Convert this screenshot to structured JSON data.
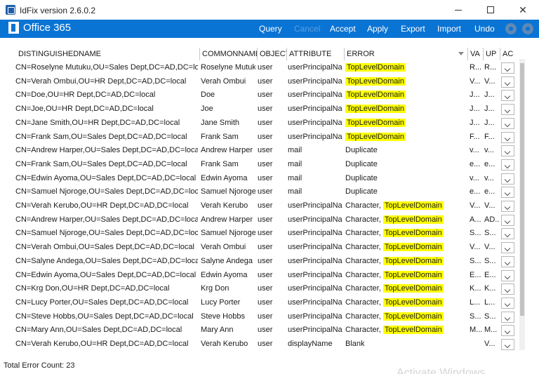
{
  "window": {
    "title": "IdFix version 2.6.0.2",
    "minimize_icon": "minimize-icon",
    "maximize_icon": "maximize-icon",
    "close_glyph": "✕"
  },
  "ribbon": {
    "brand": "Office 365",
    "menu": [
      {
        "label": "Query",
        "enabled": true
      },
      {
        "label": "Cancel",
        "enabled": false
      },
      {
        "label": "Accept",
        "enabled": true
      },
      {
        "label": "Apply",
        "enabled": true
      },
      {
        "label": "Export",
        "enabled": true
      },
      {
        "label": "Import",
        "enabled": true
      },
      {
        "label": "Undo",
        "enabled": true
      }
    ],
    "icons": [
      "gear-icon",
      "settings-icon"
    ]
  },
  "grid": {
    "columns": [
      "DISTINGUISHEDNAME",
      "COMMONNAME",
      "OBJECT",
      "ATTRIBUTE",
      "ERROR",
      "VA",
      "UP",
      "AC"
    ],
    "rows": [
      {
        "dn": "CN=Roselyne Mutuku,OU=Sales Dept,DC=AD,DC=local",
        "cn": "Roselyne Mutuku",
        "obj": "user",
        "attr": "userPrincipalNa...",
        "err_prefix": "",
        "err_hl": "TopLevelDomain",
        "va": "R...",
        "up": "R...",
        "action": ""
      },
      {
        "dn": "CN=Verah Ombui,OU=HR Dept,DC=AD,DC=local",
        "cn": "Verah Ombui",
        "obj": "user",
        "attr": "userPrincipalNa...",
        "err_prefix": "",
        "err_hl": "TopLevelDomain",
        "va": "V...",
        "up": "V...",
        "action": ""
      },
      {
        "dn": "CN=Doe,OU=HR Dept,DC=AD,DC=local",
        "cn": "Doe",
        "obj": "user",
        "attr": "userPrincipalNa...",
        "err_prefix": "",
        "err_hl": "TopLevelDomain",
        "va": "J...",
        "up": "J...",
        "action": ""
      },
      {
        "dn": "CN=Joe,OU=HR Dept,DC=AD,DC=local",
        "cn": "Joe",
        "obj": "user",
        "attr": "userPrincipalNa...",
        "err_prefix": "",
        "err_hl": "TopLevelDomain",
        "va": "J...",
        "up": "J...",
        "action": ""
      },
      {
        "dn": "CN=Jane Smith,OU=HR Dept,DC=AD,DC=local",
        "cn": "Jane Smith",
        "obj": "user",
        "attr": "userPrincipalNa...",
        "err_prefix": "",
        "err_hl": "TopLevelDomain",
        "va": "J...",
        "up": "J...",
        "action": ""
      },
      {
        "dn": "CN=Frank Sam,OU=Sales Dept,DC=AD,DC=local",
        "cn": "Frank Sam",
        "obj": "user",
        "attr": "userPrincipalNa...",
        "err_prefix": "",
        "err_hl": "TopLevelDomain",
        "va": "F...",
        "up": "F...",
        "action": ""
      },
      {
        "dn": "CN=Andrew Harper,OU=Sales Dept,DC=AD,DC=local",
        "cn": "Andrew Harper",
        "obj": "user",
        "attr": "mail",
        "err_prefix": "Duplicate",
        "err_hl": "",
        "va": "v...",
        "up": "v...",
        "action": ""
      },
      {
        "dn": "CN=Frank Sam,OU=Sales Dept,DC=AD,DC=local",
        "cn": "Frank Sam",
        "obj": "user",
        "attr": "mail",
        "err_prefix": "Duplicate",
        "err_hl": "",
        "va": "e...",
        "up": "e...",
        "action": ""
      },
      {
        "dn": "CN=Edwin Ayoma,OU=Sales Dept,DC=AD,DC=local",
        "cn": "Edwin Ayoma",
        "obj": "user",
        "attr": "mail",
        "err_prefix": "Duplicate",
        "err_hl": "",
        "va": "v...",
        "up": "v...",
        "action": ""
      },
      {
        "dn": "CN=Samuel Njoroge,OU=Sales Dept,DC=AD,DC=local",
        "cn": "Samuel Njoroge",
        "obj": "user",
        "attr": "mail",
        "err_prefix": "Duplicate",
        "err_hl": "",
        "va": "e...",
        "up": "e...",
        "action": ""
      },
      {
        "dn": "CN=Verah Kerubo,OU=HR Dept,DC=AD,DC=local",
        "cn": "Verah Kerubo",
        "obj": "user",
        "attr": "userPrincipalNa...",
        "err_prefix": "Character, ",
        "err_hl": "TopLevelDomain",
        "va": "V...",
        "up": "V...",
        "action": ""
      },
      {
        "dn": "CN=Andrew Harper,OU=Sales Dept,DC=AD,DC=local",
        "cn": "Andrew Harper",
        "obj": "user",
        "attr": "userPrincipalNa...",
        "err_prefix": "Character, ",
        "err_hl": "TopLevelDomain",
        "va": "A...",
        "up": "AD...",
        "action": ""
      },
      {
        "dn": "CN=Samuel Njoroge,OU=Sales Dept,DC=AD,DC=local",
        "cn": "Samuel Njoroge",
        "obj": "user",
        "attr": "userPrincipalNa...",
        "err_prefix": "Character, ",
        "err_hl": "TopLevelDomain",
        "va": "S...",
        "up": "S...",
        "action": ""
      },
      {
        "dn": "CN=Verah Ombui,OU=Sales Dept,DC=AD,DC=local",
        "cn": "Verah Ombui",
        "obj": "user",
        "attr": "userPrincipalNa...",
        "err_prefix": "Character, ",
        "err_hl": "TopLevelDomain",
        "va": "V...",
        "up": "V...",
        "action": ""
      },
      {
        "dn": "CN=Salyne Andega,OU=Sales Dept,DC=AD,DC=local",
        "cn": "Salyne Andega",
        "obj": "user",
        "attr": "userPrincipalNa...",
        "err_prefix": "Character, ",
        "err_hl": "TopLevelDomain",
        "va": "S...",
        "up": "S...",
        "action": ""
      },
      {
        "dn": "CN=Edwin Ayoma,OU=Sales Dept,DC=AD,DC=local",
        "cn": "Edwin Ayoma",
        "obj": "user",
        "attr": "userPrincipalNa...",
        "err_prefix": "Character, ",
        "err_hl": "TopLevelDomain",
        "va": "E...",
        "up": "E...",
        "action": ""
      },
      {
        "dn": "CN=Krg Don,OU=HR Dept,DC=AD,DC=local",
        "cn": "Krg Don",
        "obj": "user",
        "attr": "userPrincipalNa...",
        "err_prefix": "Character, ",
        "err_hl": "TopLevelDomain",
        "va": "K...",
        "up": "K...",
        "action": ""
      },
      {
        "dn": "CN=Lucy Porter,OU=Sales Dept,DC=AD,DC=local",
        "cn": "Lucy Porter",
        "obj": "user",
        "attr": "userPrincipalNa...",
        "err_prefix": "Character, ",
        "err_hl": "TopLevelDomain",
        "va": "L...",
        "up": "L...",
        "action": ""
      },
      {
        "dn": "CN=Steve Hobbs,OU=Sales Dept,DC=AD,DC=local",
        "cn": "Steve Hobbs",
        "obj": "user",
        "attr": "userPrincipalNa...",
        "err_prefix": "Character, ",
        "err_hl": "TopLevelDomain",
        "va": "S...",
        "up": "S...",
        "action": ""
      },
      {
        "dn": "CN=Mary Ann,OU=Sales Dept,DC=AD,DC=local",
        "cn": "Mary Ann",
        "obj": "user",
        "attr": "userPrincipalNa...",
        "err_prefix": "Character, ",
        "err_hl": "TopLevelDomain",
        "va": "M...",
        "up": "M...",
        "action": ""
      },
      {
        "dn": "CN=Verah Kerubo,OU=HR Dept,DC=AD,DC=local",
        "cn": "Verah Kerubo",
        "obj": "user",
        "attr": "displayName",
        "err_prefix": "Blank",
        "err_hl": "",
        "va": "",
        "up": "V...",
        "action": ""
      }
    ]
  },
  "status": {
    "total_error_count": "Total Error Count: 23"
  },
  "watermark": "Activate Windows",
  "colors": {
    "ribbon": "#0a74d4",
    "highlight": "#ffff00"
  }
}
